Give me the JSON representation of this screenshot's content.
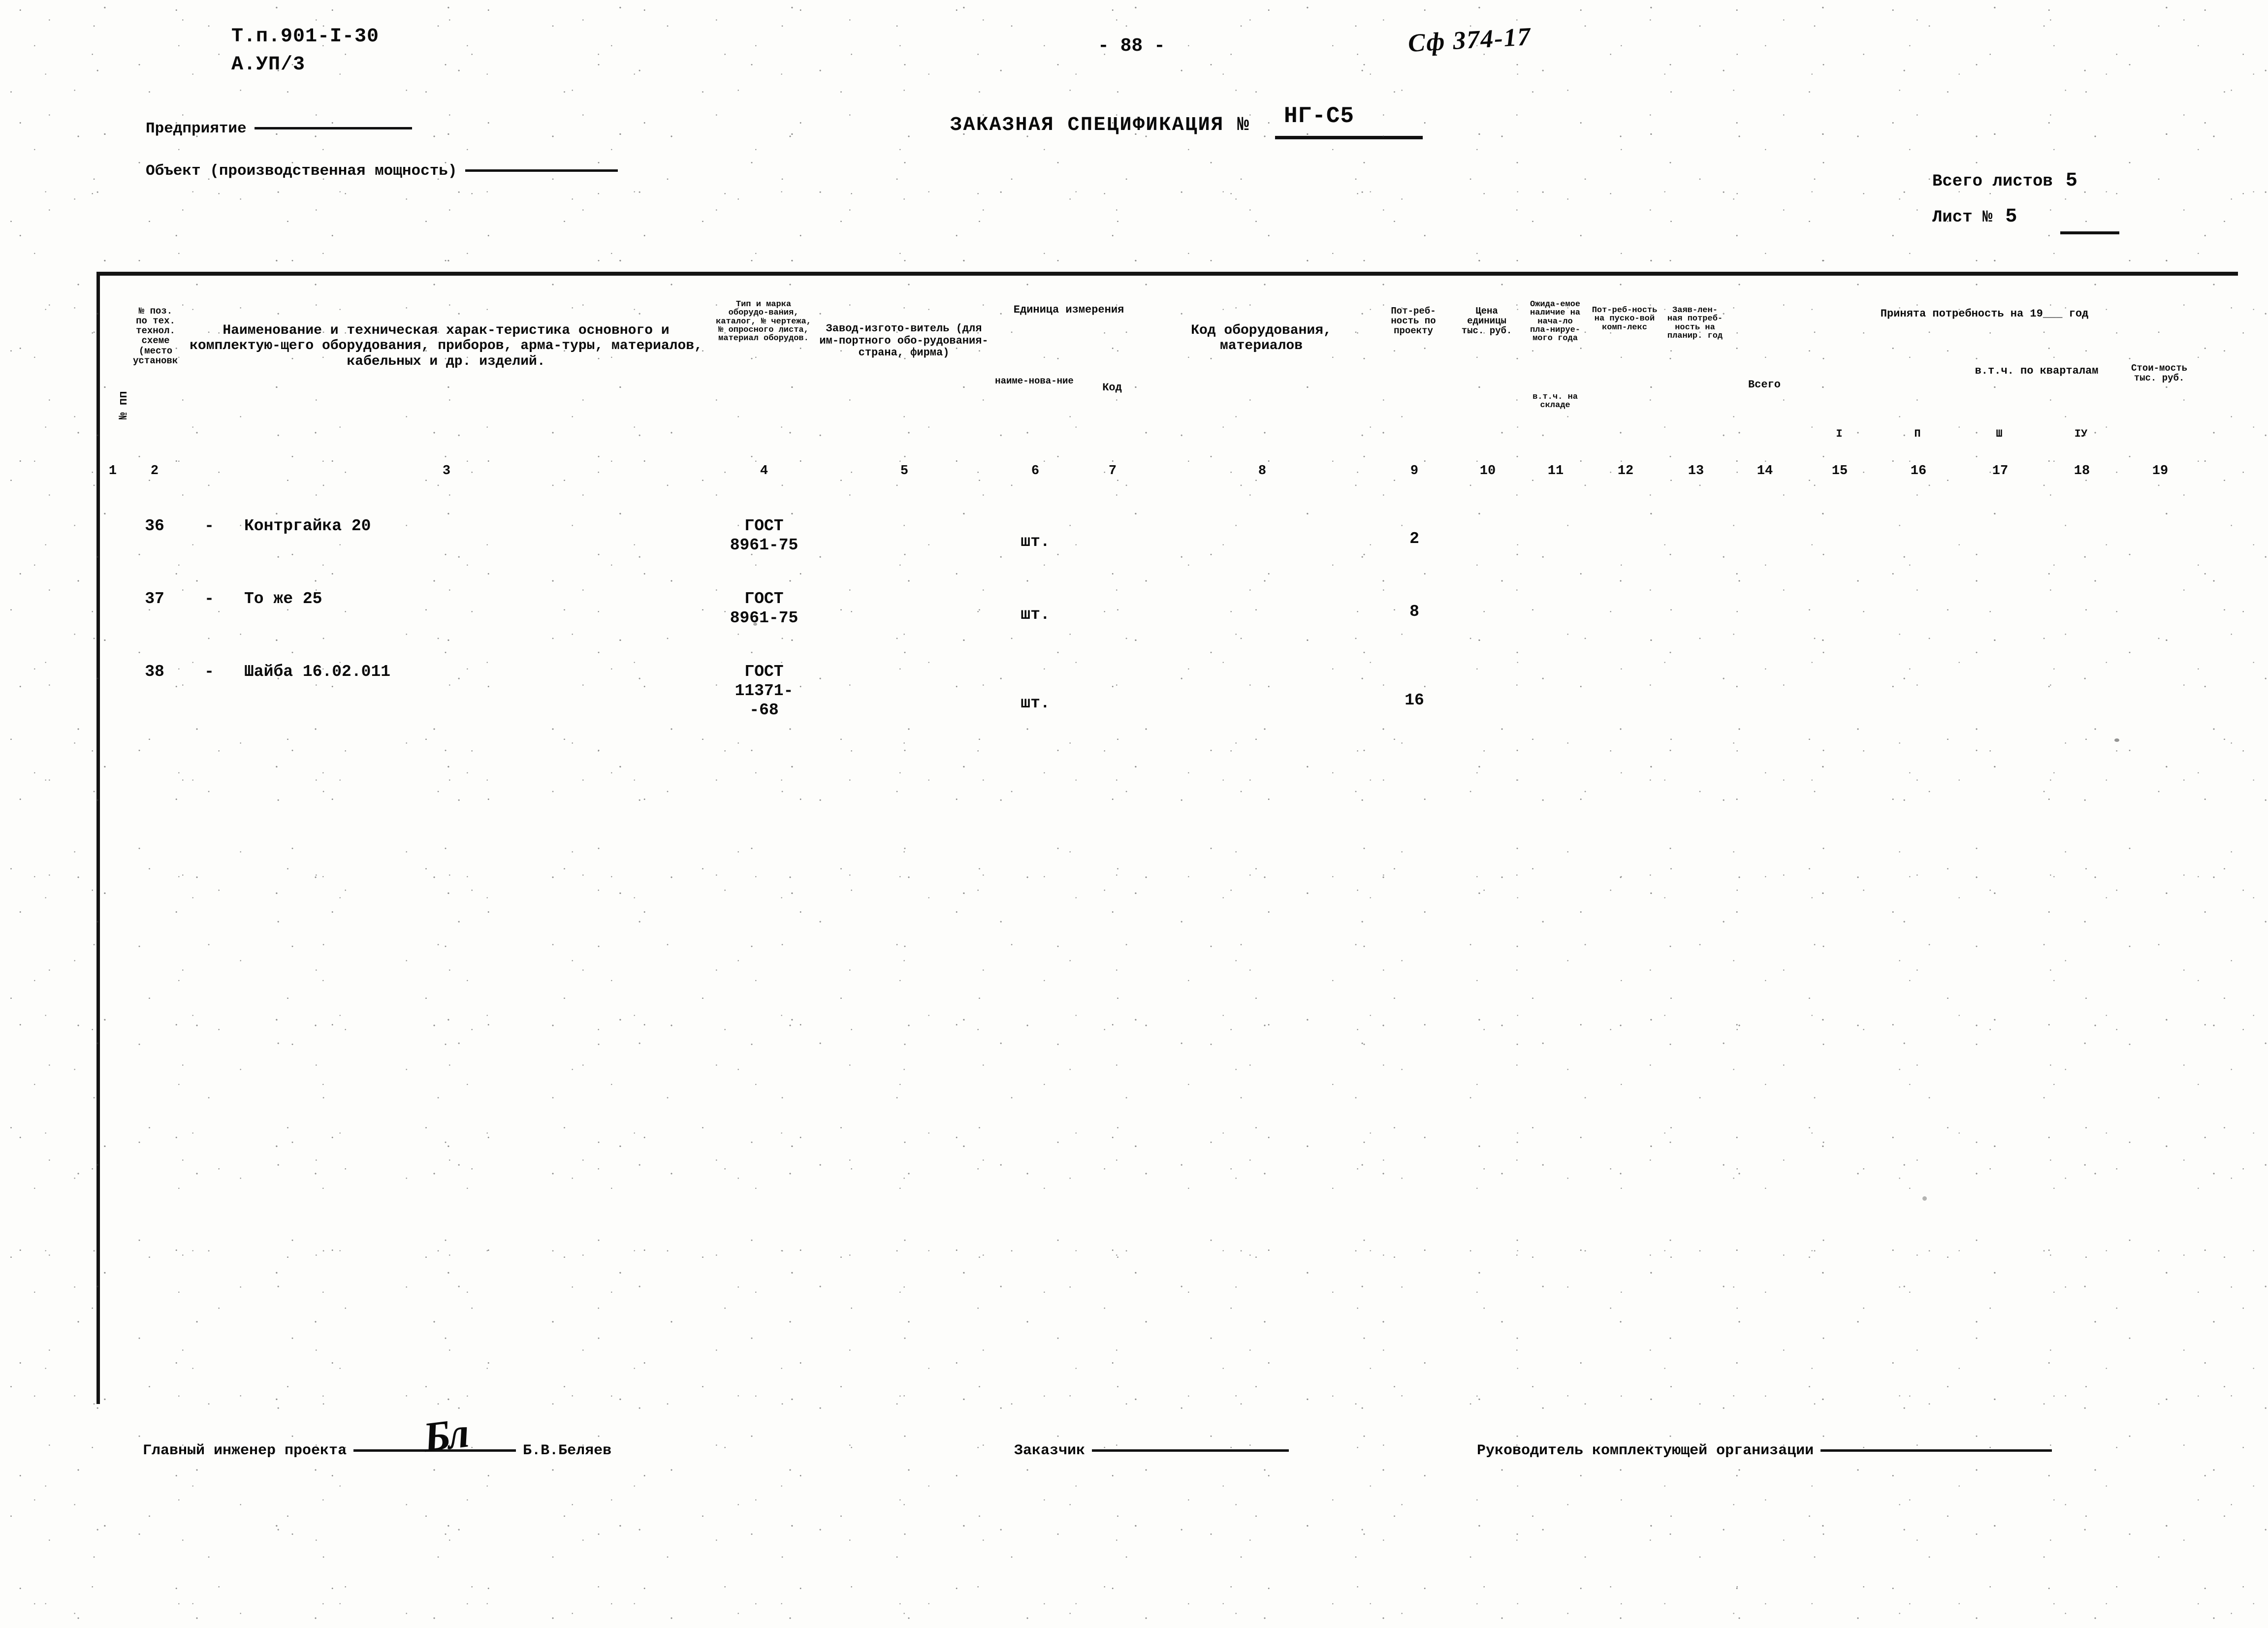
{
  "header": {
    "doc_code_line1": "Т.п.901-I-30",
    "doc_code_line2": "А.УП/3",
    "page_number": "- 88 -",
    "archive_mark": "Сф 374-17",
    "spec_title": "ЗАКАЗНАЯ СПЕЦИФИКАЦИЯ №",
    "spec_number": "НГ-С5",
    "field_enterprise_label": "Предприятие",
    "field_object_label": "Объект (производственная мощность)",
    "sheets_total_label": "Всего листов",
    "sheets_total_value": "5",
    "sheet_no_label": "Лист №",
    "sheet_no_value": "5"
  },
  "table": {
    "headers": {
      "col1": "№ пп",
      "col2": "№ поз. по тех. технол. схеме (место установки)",
      "col3": "Наименование и техническая харак-теристика основного и комплектую-щего оборудования, приборов, арма-туры, материалов, кабельных и др. изделий.",
      "col4": "Тип и марка оборудо-вания, каталог, № чертежа, № опросного листа, материал оборудов.",
      "col5": "Завод-изгото-витель (для им-портного обо-рудования-страна, фирма)",
      "col6_group": "Единица измерения",
      "col6": "наиме-нова-ние",
      "col7": "Код",
      "col8": "Код оборудования, материалов",
      "col9": "Пот-реб-ность по проекту",
      "col10": "Цена единицы тыс. руб.",
      "col11": "Пот-реб-ность на пуско-вой комп-лекс",
      "col12": "Ожида-емое наличие на нача-ло пла-нируе-мого года",
      "col12b": "в.т.ч. на складе",
      "col13": "Заяв-лен-ная потреб-ность на планир. год",
      "col14_group": "Принята потребность на 19___ год",
      "col14": "Всего",
      "col15_group": "в.т.ч. по кварталам",
      "col15": "I",
      "col16": "П",
      "col17": "Ш",
      "col18": "IУ",
      "col19": "Стои-мость тыс. руб."
    },
    "column_numbers": [
      "1",
      "2",
      "3",
      "4",
      "5",
      "6",
      "7",
      "8",
      "9",
      "10",
      "11",
      "12",
      "13",
      "14",
      "15",
      "16",
      "17",
      "18",
      "19"
    ],
    "rows": [
      {
        "num": "36",
        "pos": "-",
        "name": "Контргайка 20",
        "type": "ГОСТ\n8961-75",
        "plant": "",
        "unit": "шт.",
        "unit_code": "",
        "equip_code": "",
        "qty_project": "2",
        "price": "",
        "qty_startup": "",
        "expected": "",
        "in_stock": "",
        "declared": "",
        "total": "",
        "q1": "",
        "q2": "",
        "q3": "",
        "q4": "",
        "cost": ""
      },
      {
        "num": "37",
        "pos": "-",
        "name": "То же 25",
        "type": "ГОСТ\n8961-75",
        "plant": "",
        "unit": "шт.",
        "unit_code": "",
        "equip_code": "",
        "qty_project": "8",
        "price": "",
        "qty_startup": "",
        "expected": "",
        "in_stock": "",
        "declared": "",
        "total": "",
        "q1": "",
        "q2": "",
        "q3": "",
        "q4": "",
        "cost": ""
      },
      {
        "num": "38",
        "pos": "-",
        "name": "Шайба 16.02.011",
        "type": "ГОСТ\n11371-\n-68",
        "plant": "",
        "unit": "шт.",
        "unit_code": "",
        "equip_code": "",
        "qty_project": "16",
        "price": "",
        "qty_startup": "",
        "expected": "",
        "in_stock": "",
        "declared": "",
        "total": "",
        "q1": "",
        "q2": "",
        "q3": "",
        "q4": "",
        "cost": ""
      }
    ]
  },
  "footer": {
    "chief_engineer_label": "Главный инженер проекта",
    "chief_engineer_name": "Б.В.Беляев",
    "signature_glyph": "Бл",
    "customer_label": "Заказчик",
    "supply_org_label": "Руководитель комплектующей организации"
  }
}
